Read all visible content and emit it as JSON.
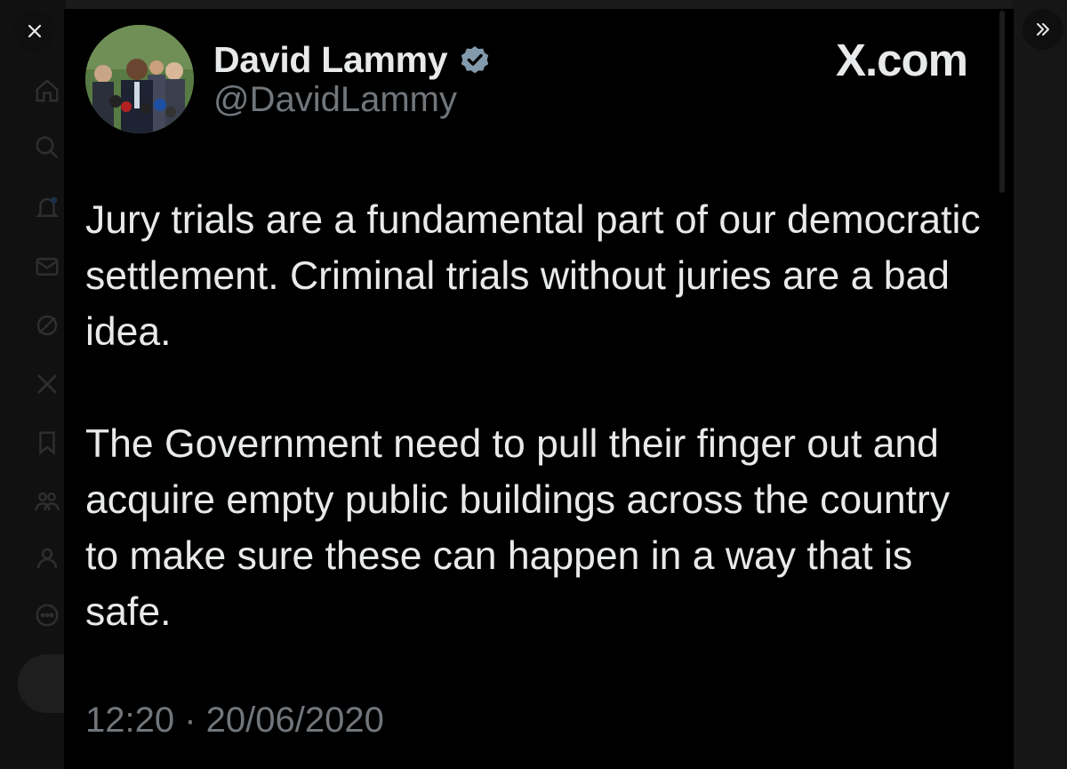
{
  "tweet": {
    "author_name": "David Lammy",
    "handle": "@DavidLammy",
    "brand": "X.com",
    "paragraphs": [
      "Jury trials are a fundamental part of our democratic settlement. Criminal trials without juries are a bad idea.",
      "The Government need to pull their finger out and acquire empty public buildings across the country to make sure these can happen in a way that is safe."
    ],
    "timestamp": "12:20 · 20/06/2020"
  },
  "icons": {
    "close": "close-icon",
    "next": "double-chevron-right-icon",
    "verified": "verified-badge-icon",
    "sidebar": [
      "home-icon",
      "search-icon",
      "notifications-icon",
      "messages-icon",
      "grok-icon",
      "x-icon",
      "bookmark-icon",
      "communities-icon",
      "profile-icon",
      "more-icon"
    ]
  },
  "colors": {
    "background": "#000000",
    "primary_text": "#e7e9ea",
    "secondary_text": "#71767b",
    "verified": "#829aab"
  }
}
